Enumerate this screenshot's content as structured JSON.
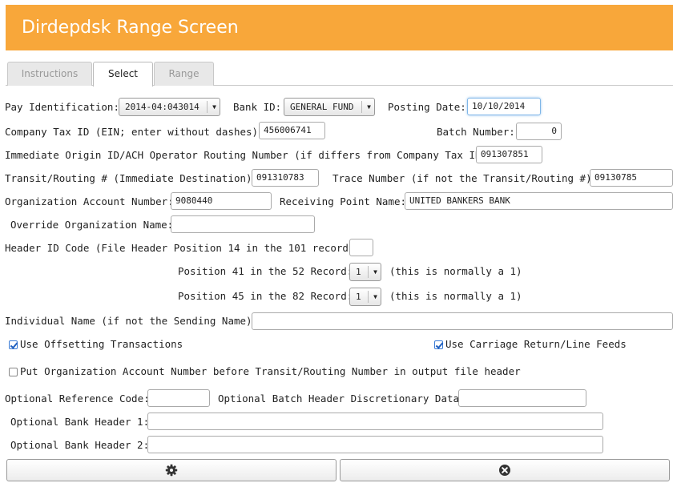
{
  "title": "Dirdepdsk Range Screen",
  "tabs": [
    {
      "label": "Instructions"
    },
    {
      "label": "Select"
    },
    {
      "label": "Range"
    }
  ],
  "form": {
    "pay_identification": {
      "label": "Pay Identification:",
      "value": "2014-04:043014"
    },
    "bank_id": {
      "label": "Bank ID:",
      "value": "GENERAL FUND"
    },
    "posting_date": {
      "label": "Posting Date:",
      "value": "10/10/2014"
    },
    "company_tax_id": {
      "label": "Company Tax ID (EIN; enter without dashes):",
      "value": "456006741"
    },
    "batch_number": {
      "label": "Batch Number:",
      "value": "0"
    },
    "immediate_origin": {
      "label": "Immediate Origin ID/ACH Operator Routing Number (if differs from Company Tax ID):",
      "value": "091307851"
    },
    "transit_routing": {
      "label": "Transit/Routing # (Immediate Destination):",
      "value": "091310783"
    },
    "trace_number": {
      "label": "Trace Number (if not the Transit/Routing #):",
      "value": "09130785"
    },
    "org_account_number": {
      "label": "Organization Account Number:",
      "value": "9080440"
    },
    "receiving_point_name": {
      "label": "Receiving Point Name:",
      "value": "UNITED BANKERS BANK"
    },
    "override_org_name": {
      "label": "Override Organization Name:",
      "value": ""
    },
    "header_id_code": {
      "label": "Header ID Code (File Header Position 14 in the 101 record):",
      "value": ""
    },
    "position_41": {
      "label": "Position 41 in the 52 Record:",
      "value": "1",
      "note": "(this is normally a 1)"
    },
    "position_45": {
      "label": "Position 45 in the 82 Record:",
      "value": "1",
      "note": "(this is normally a 1)"
    },
    "individual_name": {
      "label": "Individual Name (if not the Sending Name):",
      "value": ""
    },
    "use_offsetting": {
      "label": "Use Offsetting Transactions",
      "checked": true
    },
    "use_crlf": {
      "label": "Use Carriage Return/Line Feeds",
      "checked": true
    },
    "put_org_account": {
      "label": "Put Organization Account Number before Transit/Routing Number in output file header",
      "checked": false
    },
    "optional_reference_code": {
      "label": "Optional Reference Code:",
      "value": ""
    },
    "optional_batch_header": {
      "label": "Optional Batch Header Discretionary Data:",
      "value": ""
    },
    "optional_bank_header_1": {
      "label": "Optional Bank Header 1:",
      "value": ""
    },
    "optional_bank_header_2": {
      "label": "Optional Bank Header 2:",
      "value": ""
    }
  },
  "buttons": {
    "process_icon": "gear-icon",
    "cancel_icon": "close-circle-icon"
  },
  "colors": {
    "title_bar": "#f8a73a",
    "focus_border": "#7fb6e8"
  }
}
